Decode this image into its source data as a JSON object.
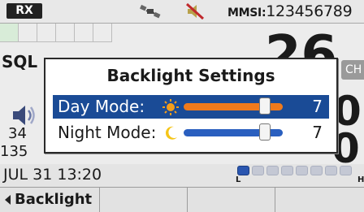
{
  "status_bar": {
    "rx_badge": "RX",
    "gps_icon": "satellite-icon",
    "mute_icon": "speaker-muted-icon",
    "mmsi_label": "MMSI:",
    "mmsi_value": "123456789"
  },
  "background": {
    "sql_label": "SQL",
    "channel_partial": "26",
    "ch_tab": "CH",
    "volume_icon": "speaker-volume-icon",
    "freq_fragment_a": "34",
    "freq_fragment_b": "135",
    "right_digit_a": "0",
    "right_digit_b": "0",
    "datetime": "JUL 31 13:20",
    "meter_low": "L",
    "meter_high": "H",
    "meter_level_fraction": 0.125
  },
  "menu": {
    "left_arrow_icon": "left-arrow-icon",
    "current_label": "Backlight"
  },
  "dialog": {
    "title": "Backlight Settings",
    "rows": [
      {
        "label": "Day Mode:",
        "icon": "sun-icon",
        "value": "7",
        "level_fraction": 0.82,
        "selected": true
      },
      {
        "label": "Night Mode:",
        "icon": "moon-icon",
        "value": "7",
        "level_fraction": 0.82,
        "selected": false
      }
    ]
  },
  "colors": {
    "selection_blue": "#1a4b96",
    "day_track_orange": "#f07a1c",
    "night_track_blue": "#2a5fbf",
    "sun_orange": "#f59e1a",
    "moon_yellow": "#f5c518",
    "meter_blue": "#2a56b0",
    "mute_red": "#c0282c"
  }
}
